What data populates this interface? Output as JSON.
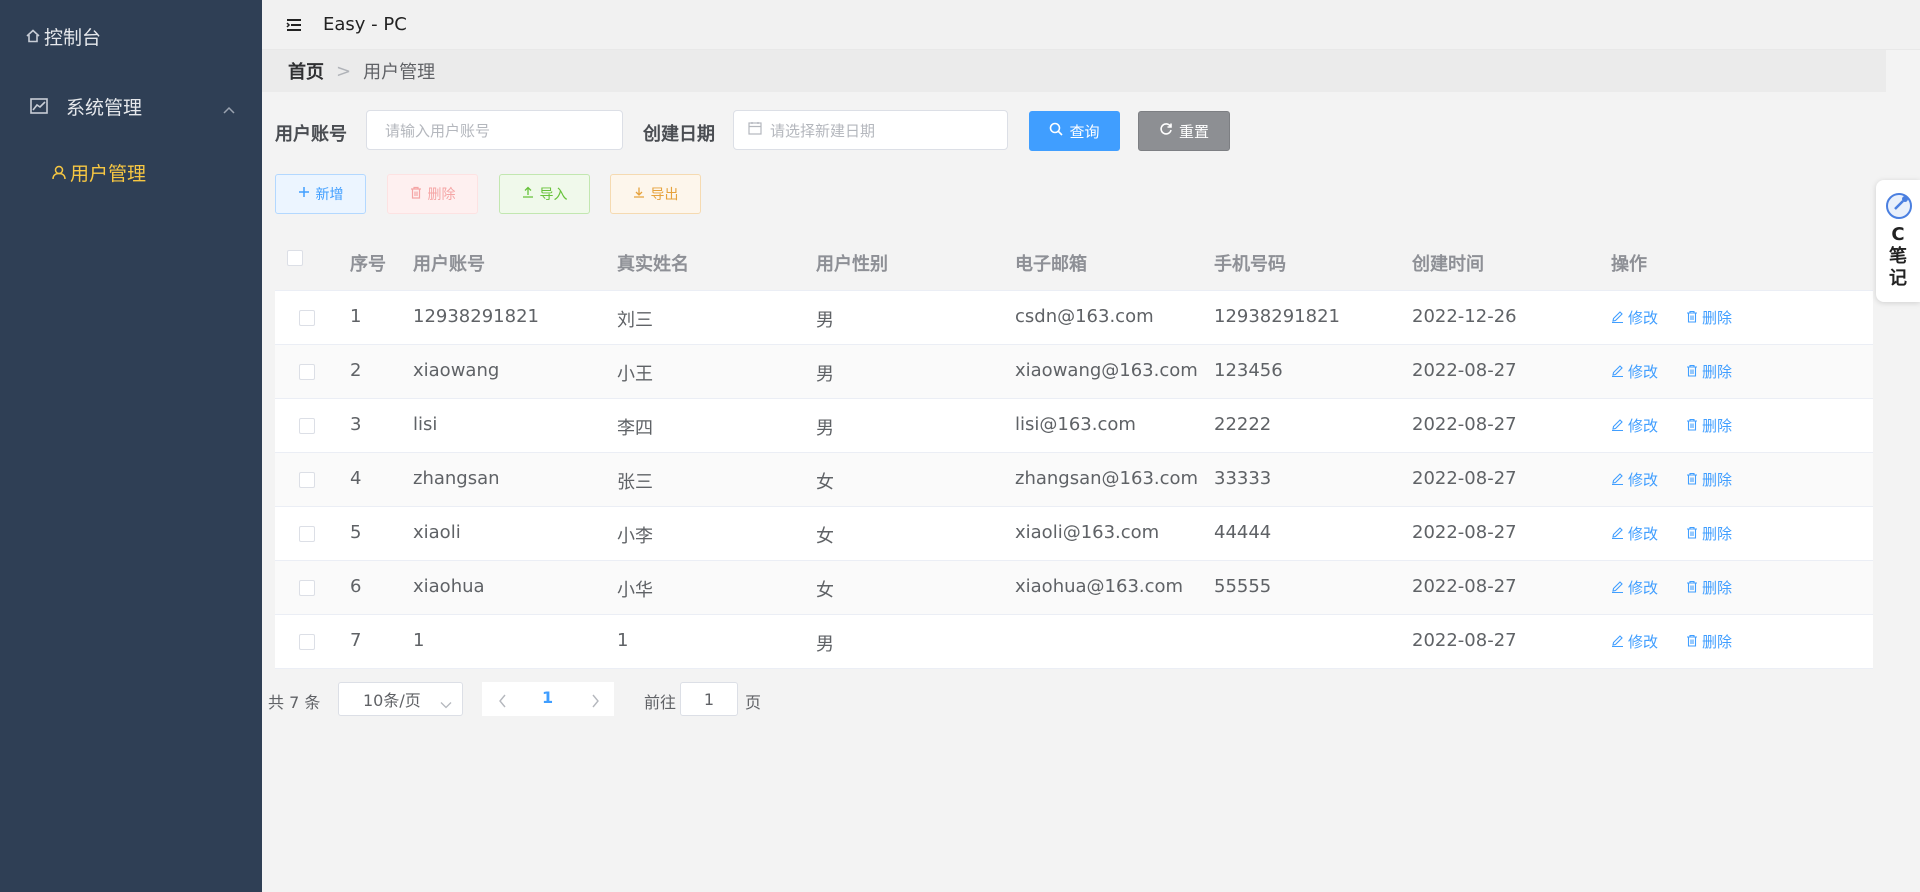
{
  "sidebar": {
    "dashboard_label": "控制台",
    "system_label": "系统管理",
    "user_label": "用户管理"
  },
  "topbar": {
    "title": "Easy - PC"
  },
  "breadcrumb": {
    "home": "首页",
    "separator": ">",
    "current": "用户管理"
  },
  "search": {
    "account_label": "用户账号",
    "account_placeholder": "请输入用户账号",
    "date_label": "创建日期",
    "date_placeholder": "请选择新建日期",
    "query_label": "查询",
    "reset_label": "重置"
  },
  "actions": {
    "add": "新增",
    "delete": "删除",
    "import": "导入",
    "export": "导出"
  },
  "table": {
    "headers": {
      "no": "序号",
      "account": "用户账号",
      "name": "真实姓名",
      "sex": "用户性别",
      "email": "电子邮箱",
      "phone": "手机号码",
      "created": "创建时间",
      "ops": "操作"
    },
    "edit_label": "修改",
    "delete_label": "删除",
    "rows": [
      {
        "no": "1",
        "account": "12938291821",
        "name": "刘三",
        "sex": "男",
        "email": "csdn@163.com",
        "phone": "12938291821",
        "created": "2022-12-26"
      },
      {
        "no": "2",
        "account": "xiaowang",
        "name": "小王",
        "sex": "男",
        "email": "xiaowang@163.com",
        "phone": "123456",
        "created": "2022-08-27"
      },
      {
        "no": "3",
        "account": "lisi",
        "name": "李四",
        "sex": "男",
        "email": "lisi@163.com",
        "phone": "22222",
        "created": "2022-08-27"
      },
      {
        "no": "4",
        "account": "zhangsan",
        "name": "张三",
        "sex": "女",
        "email": "zhangsan@163.com",
        "phone": "33333",
        "created": "2022-08-27"
      },
      {
        "no": "5",
        "account": "xiaoli",
        "name": "小李",
        "sex": "女",
        "email": "xiaoli@163.com",
        "phone": "44444",
        "created": "2022-08-27"
      },
      {
        "no": "6",
        "account": "xiaohua",
        "name": "小华",
        "sex": "女",
        "email": "xiaohua@163.com",
        "phone": "55555",
        "created": "2022-08-27"
      },
      {
        "no": "7",
        "account": "1",
        "name": "1",
        "sex": "男",
        "email": "",
        "phone": "",
        "created": "2022-08-27"
      }
    ]
  },
  "pagination": {
    "total": "共 7 条",
    "page_size": "10条/页",
    "current_page": "1",
    "goto_label": "前往",
    "goto_value": "1",
    "page_unit": "页"
  },
  "note_widget": {
    "text": "C笔记"
  },
  "colors": {
    "sidebar_bg": "#2f3f55",
    "accent_yellow": "#f7c742",
    "primary": "#409eff"
  }
}
